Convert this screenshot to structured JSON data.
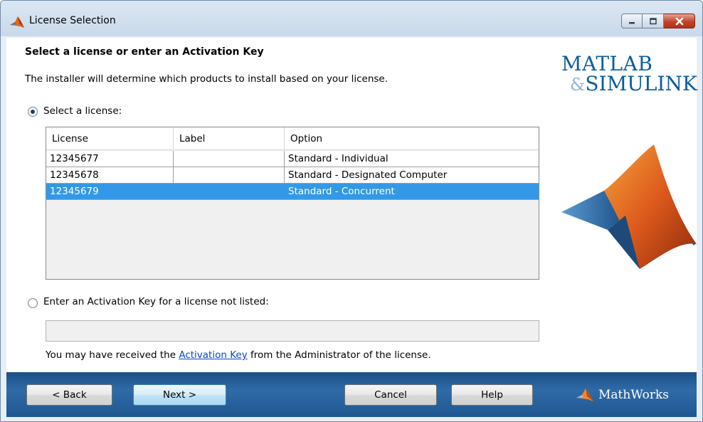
{
  "window": {
    "title": "License Selection",
    "controls": {
      "minimize": "minimize-icon",
      "maximize": "maximize-icon",
      "close": "close-icon"
    }
  },
  "main": {
    "heading": "Select a license or enter an Activation Key",
    "description": "The installer will determine which products to install based on your license.",
    "select_license_label": "Select a license:",
    "select_license_checked": true,
    "table": {
      "columns": [
        "License",
        "Label",
        "Option"
      ],
      "rows": [
        {
          "license": "12345677",
          "label": "",
          "option": "Standard - Individual",
          "selected": false
        },
        {
          "license": "12345678",
          "label": "",
          "option": "Standard - Designated Computer",
          "selected": false
        },
        {
          "license": "12345679",
          "label": "",
          "option": "Standard - Concurrent",
          "selected": true
        }
      ]
    },
    "activation_key_label": "Enter an Activation Key for a license not listed:",
    "activation_key_checked": false,
    "activation_key_value": "",
    "note_before": "You may have received the",
    "note_link": "Activation Key",
    "note_after": "from the Administrator of the license."
  },
  "logo": {
    "line1": "MATLAB",
    "line2": "SIMULINK",
    "ampersand": "&"
  },
  "footer": {
    "back_label": "< Back",
    "next_label": "Next >",
    "cancel_label": "Cancel",
    "help_label": "Help",
    "brand": "MathWorks"
  },
  "colors": {
    "selection": "#3399e6",
    "footer_bg": "#1f5690",
    "logo_blue": "#0a5d9d",
    "link": "#0645c8"
  }
}
